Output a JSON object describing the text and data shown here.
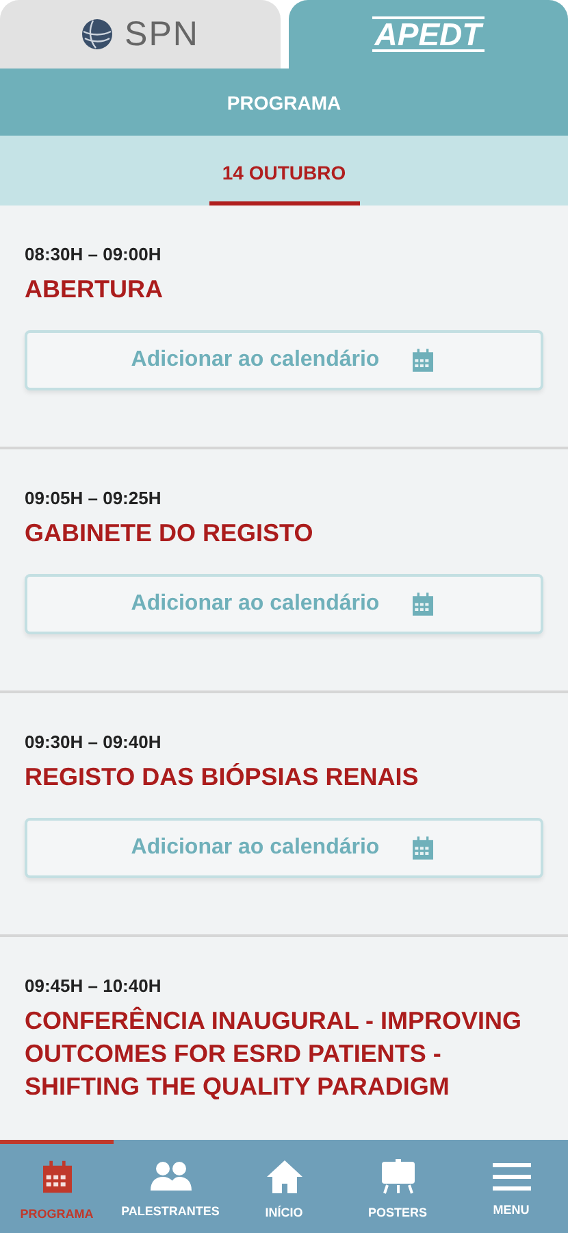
{
  "org_tabs": [
    {
      "label": "SPN",
      "selected": false
    },
    {
      "label": "APEDT",
      "selected": true
    }
  ],
  "header": {
    "title": "PROGRAMA"
  },
  "day_tabs": [
    {
      "label": "14 OUTUBRO",
      "selected": true
    }
  ],
  "sessions": [
    {
      "time": "08:30H – 09:00H",
      "title": "ABERTURA",
      "button": "Adicionar ao calendário"
    },
    {
      "time": "09:05H – 09:25H",
      "title": "GABINETE DO REGISTO",
      "button": "Adicionar ao calendário"
    },
    {
      "time": "09:30H – 09:40H",
      "title": "REGISTO DAS BIÓPSIAS RENAIS",
      "button": "Adicionar ao calendário"
    },
    {
      "time": "09:45H – 10:40H",
      "title": "CONFERÊNCIA INAUGURAL - IMPROVING OUTCOMES FOR ESRD PATIENTS - SHIFTING THE QUALITY PARADIGM"
    }
  ],
  "bottom_nav": [
    {
      "kind": "calendar",
      "label": "PROGRAMA",
      "selected": true
    },
    {
      "kind": "people",
      "label": "PALESTRANTES",
      "selected": false
    },
    {
      "kind": "home",
      "label": "INÍCIO",
      "selected": false
    },
    {
      "kind": "easel",
      "label": "POSTERS",
      "selected": false
    },
    {
      "kind": "menu",
      "label": "MENU",
      "selected": false
    }
  ]
}
